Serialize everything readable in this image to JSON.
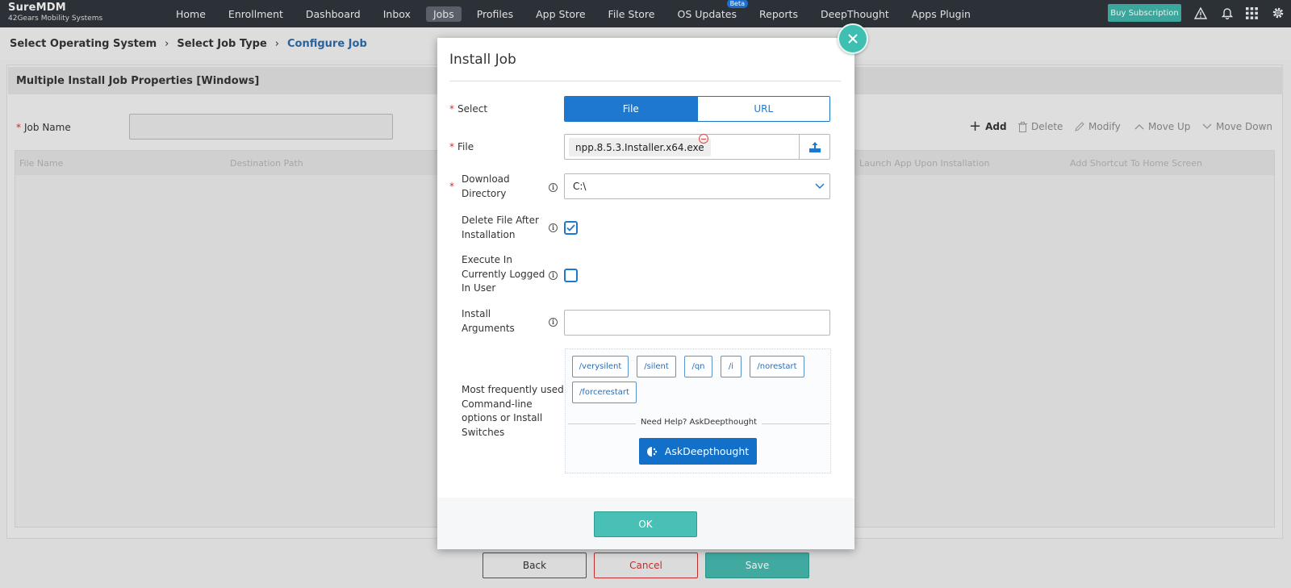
{
  "topbar": {
    "brand_name": "SureMDM",
    "brand_sub": "42Gears Mobility Systems",
    "nav": [
      "Home",
      "Enrollment",
      "Dashboard",
      "Inbox",
      "Jobs",
      "Profiles",
      "App Store",
      "File Store",
      "OS Updates",
      "Reports",
      "DeepThought",
      "Apps Plugin"
    ],
    "active_nav": "Jobs",
    "beta_label": "Beta",
    "buy_label": "Buy Subscription",
    "icons": [
      "warning-icon",
      "bell-icon",
      "apps-grid-icon",
      "gear-icon"
    ]
  },
  "breadcrumb": {
    "step1": "Select Operating System",
    "step2": "Select Job Type",
    "step3": "Configure Job"
  },
  "page": {
    "panel_title": "Multiple Install Job Properties [Windows]",
    "job_name_label": "Job Name",
    "toolbar": {
      "add": "Add",
      "delete": "Delete",
      "modify": "Modify",
      "move_up": "Move Up",
      "move_down": "Move Down"
    },
    "columns": [
      "File Name",
      "Destination Path",
      "Launch App Upon Installation",
      "Add Shortcut To Home Screen"
    ],
    "buttons": {
      "back": "Back",
      "cancel": "Cancel",
      "save": "Save"
    }
  },
  "modal": {
    "title": "Install Job",
    "select_label": "Select",
    "select_options": [
      "File",
      "URL"
    ],
    "selected_option": "File",
    "file_label": "File",
    "file_value": "npp.8.5.3.Installer.x64.exe",
    "download_dir_label_1": "Download",
    "download_dir_label_2": "Directory",
    "download_dir_value": "C:\\",
    "delete_file_label_1": "Delete File After",
    "delete_file_label_2": "Installation",
    "delete_file_checked": true,
    "execute_label_1": "Execute In",
    "execute_label_2": "Currently Logged",
    "execute_label_3": "In User",
    "execute_checked": false,
    "install_args_label_1": "Install",
    "install_args_label_2": "Arguments",
    "install_args_value": "",
    "switches_label_1": "Most frequently used",
    "switches_label_2": "Command-line",
    "switches_label_3": "options or Install",
    "switches_label_4": "Switches",
    "switches": [
      "/verysilent",
      "/silent",
      "/qn",
      "/i",
      "/norestart",
      "/forcerestart"
    ],
    "help_text": "Need Help? AskDeepthought",
    "ask_button": "AskDeepthought",
    "ok_button": "OK"
  },
  "colors": {
    "accent": "#1f78cf",
    "teal": "#48c0b6",
    "topbar": "#2c3138",
    "required": "#d0302f"
  }
}
